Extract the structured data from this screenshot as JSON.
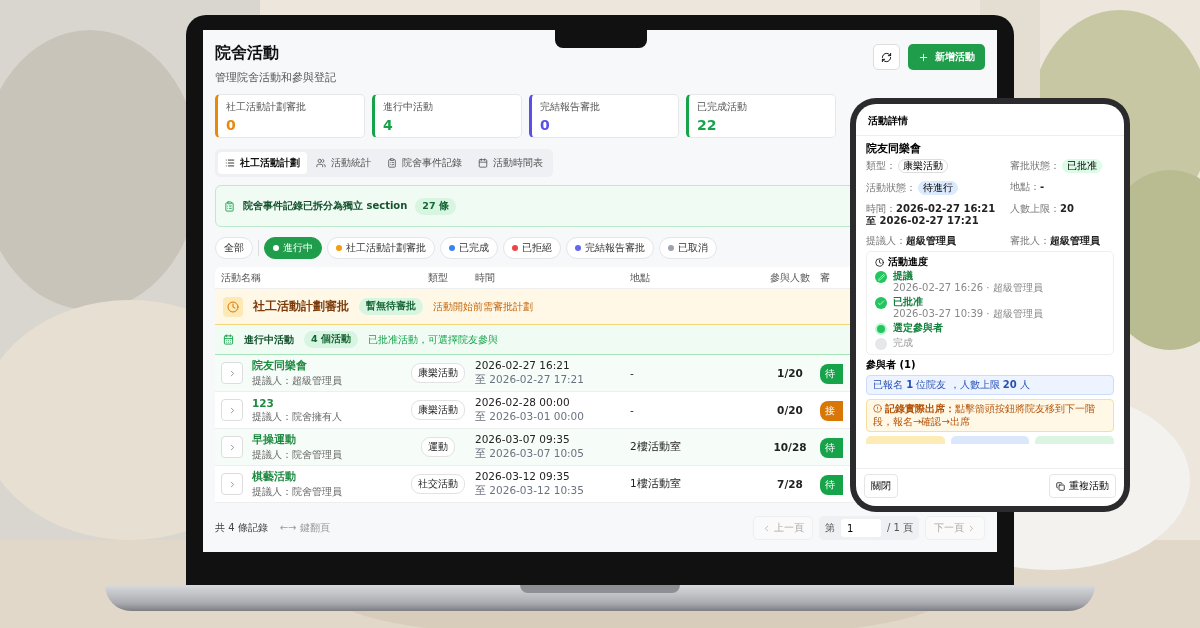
{
  "page": {
    "title": "院舍活動",
    "subtitle": "管理院舍活動和參與登記",
    "add_button": "新增活動"
  },
  "stats": [
    {
      "label": "社工活動計劃審批",
      "value": "0",
      "color": "#e8890c"
    },
    {
      "label": "進行中活動",
      "value": "4",
      "color": "#16a34a"
    },
    {
      "label": "完結報告審批",
      "value": "0",
      "color": "#5b50e6"
    },
    {
      "label": "已完成活動",
      "value": "22",
      "color": "#16a34a"
    }
  ],
  "tabs": [
    {
      "label": "社工活動計劃",
      "selected": true
    },
    {
      "label": "活動統計",
      "selected": false
    },
    {
      "label": "院舍事件記錄",
      "selected": false
    },
    {
      "label": "活動時間表",
      "selected": false
    }
  ],
  "notice": {
    "text": "院舍事件記錄已拆分為獨立 section",
    "count": "27 條"
  },
  "filters": [
    {
      "label": "全部",
      "selected": false
    },
    {
      "label": "進行中",
      "selected": true,
      "color": "#ffffff"
    },
    {
      "label": "社工活動計劃審批",
      "selected": false,
      "color": "#f59e0b"
    },
    {
      "label": "已完成",
      "selected": false,
      "color": "#3b82f6"
    },
    {
      "label": "已拒絕",
      "selected": false,
      "color": "#ef4444"
    },
    {
      "label": "完結報告審批",
      "selected": false,
      "color": "#6366f1"
    },
    {
      "label": "已取消",
      "selected": false,
      "color": "#9ca3af"
    }
  ],
  "table": {
    "columns": [
      "活動名稱",
      "類型",
      "時間",
      "地點",
      "參與人數",
      "審"
    ],
    "sections": [
      {
        "kind": "pending",
        "title": "社工活動計劃審批",
        "badge": "暫無待審批",
        "note": "活動開始前需審批計劃"
      },
      {
        "kind": "active",
        "title": "進行中活動",
        "badge": "4 個活動",
        "note": "已批准活動，可選擇院友參與"
      }
    ],
    "rows": [
      {
        "name": "院友同樂會",
        "proposer": "提議人：超級管理員",
        "type": "康樂活動",
        "start": "2026-02-27 16:21",
        "end": "至 2026-02-27 17:21",
        "location": "-",
        "participants": "1/20",
        "status": "待",
        "color": "#16a34a"
      },
      {
        "name": "123",
        "proposer": "提議人：院舍擁有人",
        "type": "康樂活動",
        "start": "2026-02-28 00:00",
        "end": "至 2026-03-01 00:00",
        "location": "-",
        "participants": "0/20",
        "status": "接",
        "color": "#d97706"
      },
      {
        "name": "早操運動",
        "proposer": "提議人：院舍管理員",
        "type": "運動",
        "start": "2026-03-07 09:35",
        "end": "至 2026-03-07 10:05",
        "location": "2樓活動室",
        "participants": "10/28",
        "status": "待",
        "color": "#16a34a"
      },
      {
        "name": "棋藝活動",
        "proposer": "提議人：院舍管理員",
        "type": "社交活動",
        "start": "2026-03-12 09:35",
        "end": "至 2026-03-12 10:35",
        "location": "1樓活動室",
        "participants": "7/28",
        "status": "待",
        "color": "#16a34a"
      }
    ]
  },
  "pagination": {
    "total": "共 4 條記錄",
    "hint": "←→ 鍵翻頁",
    "prev": "上一頁",
    "page_prefix": "第",
    "page": "1",
    "page_suffix": "/ 1 頁",
    "next": "下一頁"
  },
  "phone": {
    "title": "活動詳情",
    "name": "院友同樂會",
    "fields": [
      {
        "label": "類型：",
        "value": "康樂活動",
        "kind": "tag",
        "color": "#ffffff"
      },
      {
        "label": "活動狀態：",
        "value": "待進行",
        "kind": "tag",
        "color": "#dbeafe"
      },
      {
        "text": "時間：**2026-02-27 16:21 至 2026-02-27 17:21**",
        "kind": "text"
      },
      {
        "text": "提議人：**超級管理員**",
        "kind": "text"
      },
      {
        "label": "審批狀態：",
        "value": "已批准",
        "kind": "tag",
        "color": "#dcfce7"
      },
      {
        "text": "地點：**-**",
        "kind": "text"
      },
      {
        "text": "人數上限：**20**",
        "kind": "text"
      },
      {
        "text": "審批人：**超級管理員**",
        "kind": "text"
      }
    ],
    "timeline": {
      "title": "活動進度",
      "steps": [
        {
          "label": "提議",
          "meta": "2026-02-27 16:26 · 超級管理員",
          "done": true,
          "current": false
        },
        {
          "label": "已批准",
          "meta": "2026-03-27 10:39 · 超級管理員",
          "done": true,
          "current": false
        },
        {
          "label": "選定參與者",
          "done": false,
          "current": true
        },
        {
          "label": "完成",
          "done": false,
          "current": false
        }
      ]
    },
    "participants_title": "參與者 (1)",
    "info": "已報名 **1** 位院友 ，人數上限 **20** 人",
    "warning": "**記錄實際出席：**點擊箭頭按鈕將院友移到下一階段，報名→確認→出席",
    "stage_cards": [
      {
        "color": "#fdecb5"
      },
      {
        "color": "#dbe7fb"
      },
      {
        "color": "#dcf5e3"
      }
    ],
    "close": "關閉",
    "duplicate": "重複活動"
  }
}
